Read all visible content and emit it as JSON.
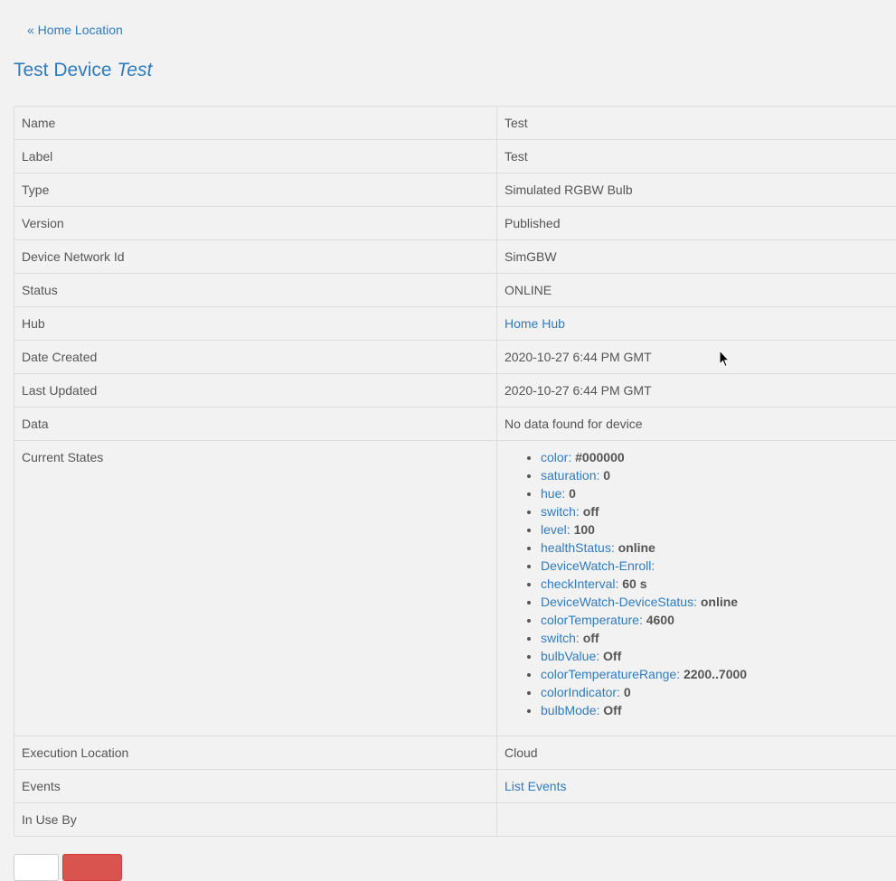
{
  "nav": {
    "back_label": "« Home Location"
  },
  "header": {
    "title_prefix": "Test Device",
    "title_name": "Test"
  },
  "details": {
    "name": {
      "label": "Name",
      "value": "Test"
    },
    "label": {
      "label": "Label",
      "value": "Test"
    },
    "type": {
      "label": "Type",
      "value": "Simulated RGBW Bulb"
    },
    "version": {
      "label": "Version",
      "value": "Published"
    },
    "network_id": {
      "label": "Device Network Id",
      "value": "SimGBW"
    },
    "status": {
      "label": "Status",
      "value": "ONLINE"
    },
    "hub": {
      "label": "Hub",
      "value": "Home Hub"
    },
    "date_created": {
      "label": "Date Created",
      "value": "2020-10-27 6:44 PM GMT"
    },
    "last_updated": {
      "label": "Last Updated",
      "value": "2020-10-27 6:44 PM GMT"
    },
    "data": {
      "label": "Data",
      "value": "No data found for device"
    },
    "current_states": {
      "label": "Current States",
      "items": [
        {
          "name": "color",
          "value": "#000000"
        },
        {
          "name": "saturation",
          "value": "0"
        },
        {
          "name": "hue",
          "value": "0"
        },
        {
          "name": "switch",
          "value": "off"
        },
        {
          "name": "level",
          "value": "100"
        },
        {
          "name": "healthStatus",
          "value": "online"
        },
        {
          "name": "DeviceWatch-Enroll",
          "value": ""
        },
        {
          "name": "checkInterval",
          "value": "60 s"
        },
        {
          "name": "DeviceWatch-DeviceStatus",
          "value": "online"
        },
        {
          "name": "colorTemperature",
          "value": "4600"
        },
        {
          "name": "switch",
          "value": "off"
        },
        {
          "name": "bulbValue",
          "value": "Off"
        },
        {
          "name": "colorTemperatureRange",
          "value": "2200..7000"
        },
        {
          "name": "colorIndicator",
          "value": "0"
        },
        {
          "name": "bulbMode",
          "value": "Off"
        }
      ]
    },
    "execution_location": {
      "label": "Execution Location",
      "value": "Cloud"
    },
    "events": {
      "label": "Events",
      "value": "List Events"
    },
    "in_use_by": {
      "label": "In Use By",
      "value": ""
    }
  },
  "colors": {
    "link": "#2f7bbf",
    "background": "#f2f2f2",
    "danger": "#d9534f"
  }
}
